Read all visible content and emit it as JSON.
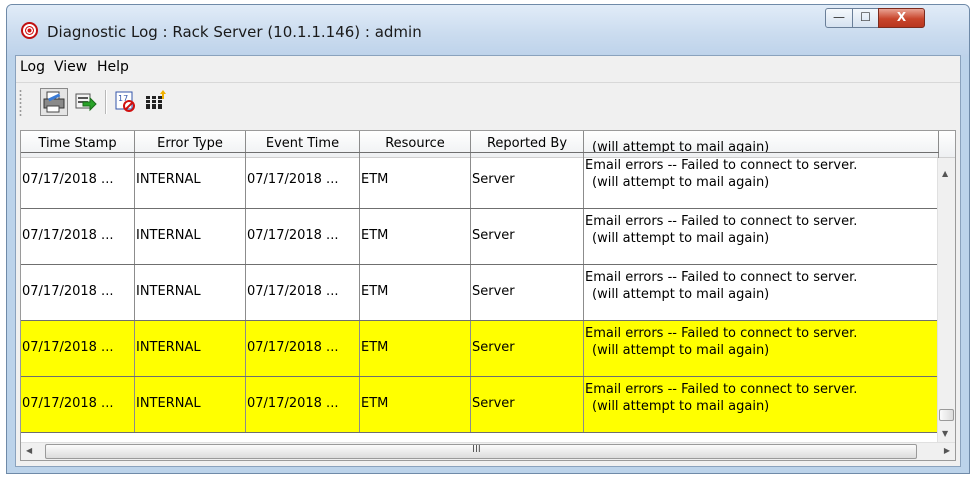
{
  "window": {
    "title": "Diagnostic Log : Rack Server (10.1.1.146) : admin",
    "controls": {
      "minimize": "—",
      "maximize": "☐",
      "close": "X"
    }
  },
  "menu": [
    "Log",
    "View",
    "Help"
  ],
  "toolbar": [
    "print-icon",
    "export-icon",
    "calendar-icon",
    "columns-icon"
  ],
  "table": {
    "columns": [
      "Time Stamp",
      "Error Type",
      "Event Time",
      "Resource",
      "Reported By",
      ""
    ],
    "partial_row_text": "(will attempt to mail again)",
    "rows": [
      {
        "time_stamp": "07/17/2018 ...",
        "error_type": "INTERNAL",
        "event_time": "07/17/2018 ...",
        "resource": "ETM",
        "reported_by": "Server",
        "message_line1": "Email errors -- Failed to connect to server.",
        "message_line2": "(will attempt to mail again)",
        "highlighted": false
      },
      {
        "time_stamp": "07/17/2018 ...",
        "error_type": "INTERNAL",
        "event_time": "07/17/2018 ...",
        "resource": "ETM",
        "reported_by": "Server",
        "message_line1": "Email errors -- Failed to connect to server.",
        "message_line2": "(will attempt to mail again)",
        "highlighted": false
      },
      {
        "time_stamp": "07/17/2018 ...",
        "error_type": "INTERNAL",
        "event_time": "07/17/2018 ...",
        "resource": "ETM",
        "reported_by": "Server",
        "message_line1": "Email errors -- Failed to connect to server.",
        "message_line2": "(will attempt to mail again)",
        "highlighted": false
      },
      {
        "time_stamp": "07/17/2018 ...",
        "error_type": "INTERNAL",
        "event_time": "07/17/2018 ...",
        "resource": "ETM",
        "reported_by": "Server",
        "message_line1": "Email errors -- Failed to connect to server.",
        "message_line2": "(will attempt to mail again)",
        "highlighted": true
      },
      {
        "time_stamp": "07/17/2018 ...",
        "error_type": "INTERNAL",
        "event_time": "07/17/2018 ...",
        "resource": "ETM",
        "reported_by": "Server",
        "message_line1": "Email errors -- Failed to connect to server.",
        "message_line2": "(will attempt to mail again)",
        "highlighted": true
      }
    ]
  },
  "scrollbar": {
    "hthumb_grip": "III"
  },
  "colors": {
    "highlight": "#ffff00",
    "close_button": "#c8452b",
    "titlebar": "#cbdcef"
  }
}
